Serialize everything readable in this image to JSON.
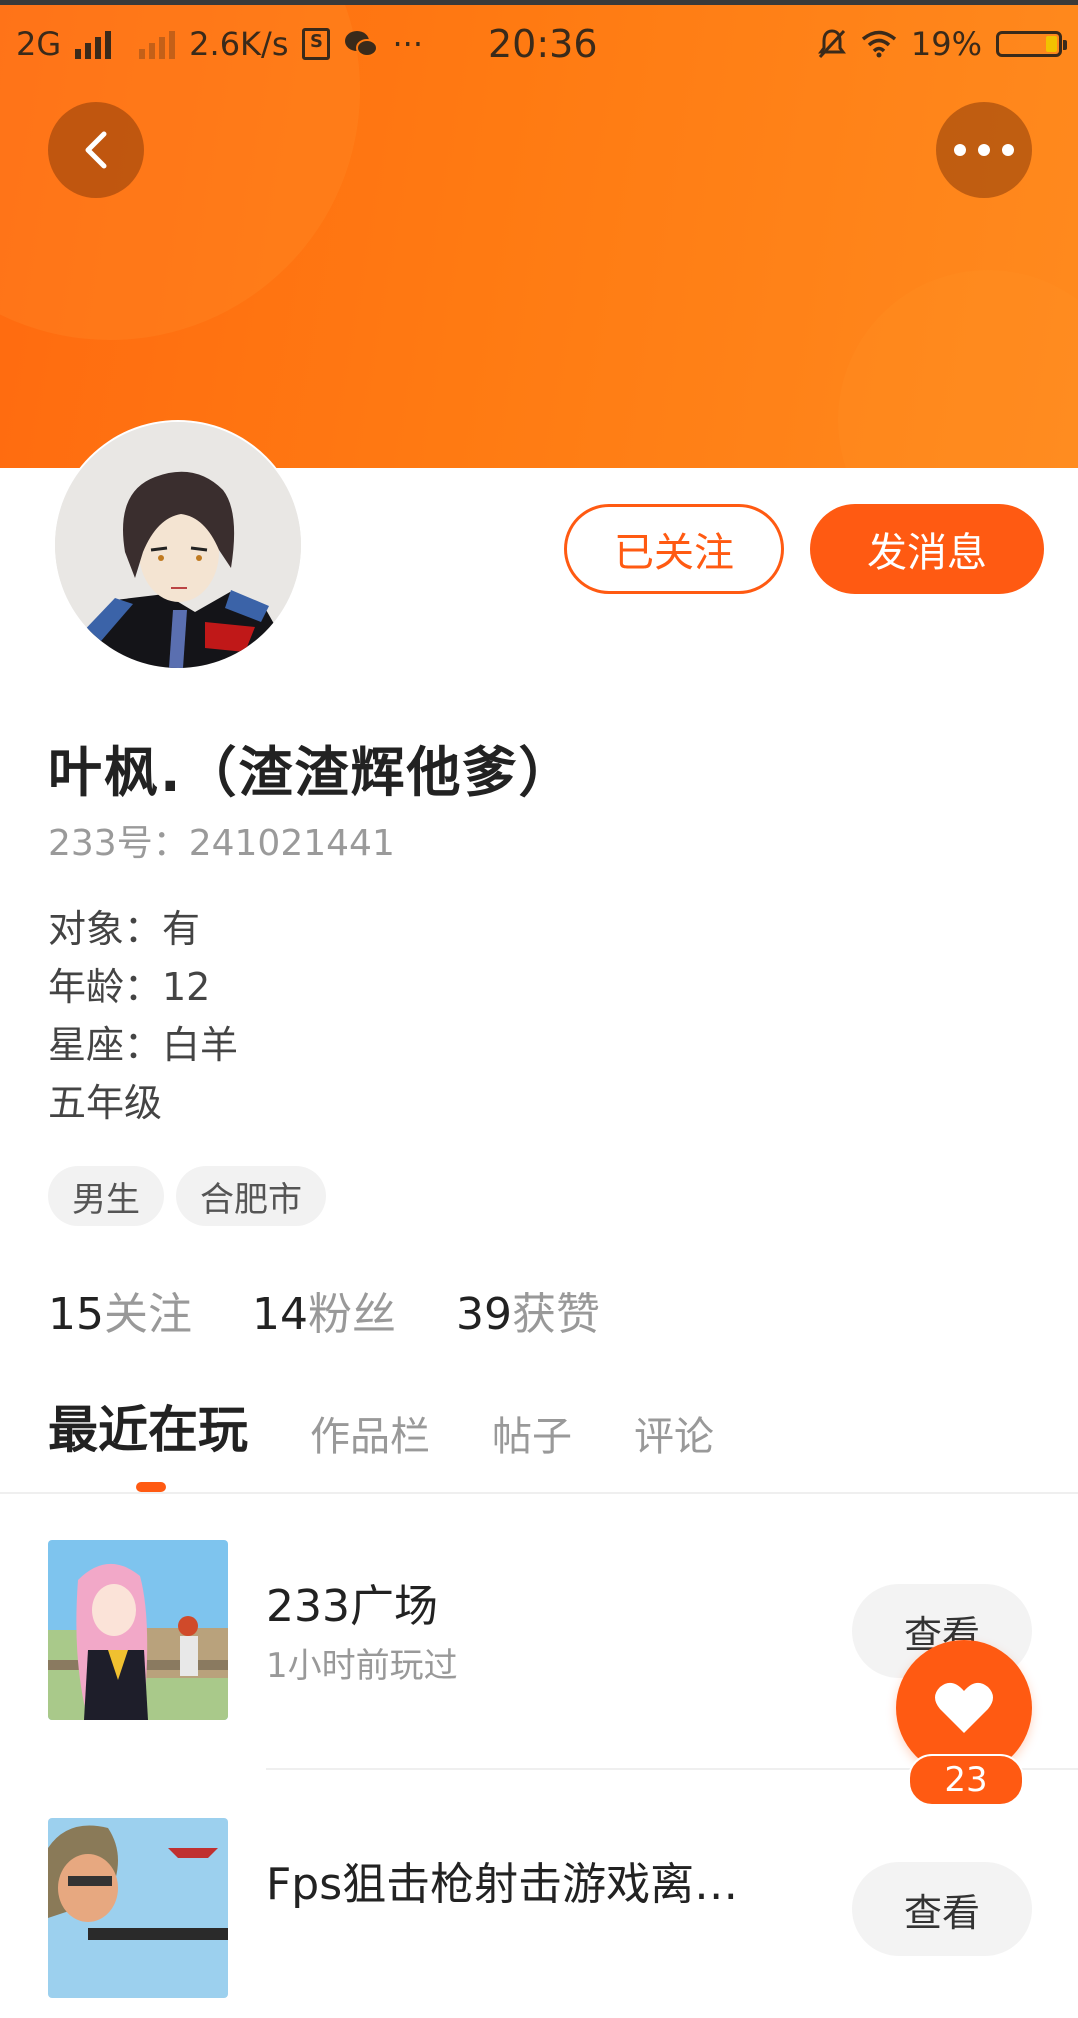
{
  "status_bar": {
    "network": "2G",
    "speed": "2.6K/s",
    "dots": "···",
    "time": "20:36",
    "battery": "19%",
    "battery_level": 0.19
  },
  "profile": {
    "name": "叶枫.（渣渣辉他爹）",
    "id_line": "233号：241021441",
    "bio": [
      "对象：有",
      "年龄：12",
      "星座：白羊",
      "五年级"
    ],
    "tags": [
      "男生",
      "合肥市"
    ],
    "follow_button": "已关注",
    "message_button": "发消息"
  },
  "stats": [
    {
      "value": "15",
      "label": "关注"
    },
    {
      "value": "14",
      "label": "粉丝"
    },
    {
      "value": "39",
      "label": "获赞"
    }
  ],
  "tabs": [
    "最近在玩",
    "作品栏",
    "帖子",
    "评论"
  ],
  "games": [
    {
      "title": "233广场",
      "subtitle": "1小时前玩过",
      "button": "查看"
    },
    {
      "title": "Fps狙击枪射击游戏离…",
      "subtitle": "",
      "button": "查看"
    }
  ],
  "like": {
    "count": "23"
  },
  "colors": {
    "accent": "#ff5a12",
    "header": "#ff7a12"
  }
}
